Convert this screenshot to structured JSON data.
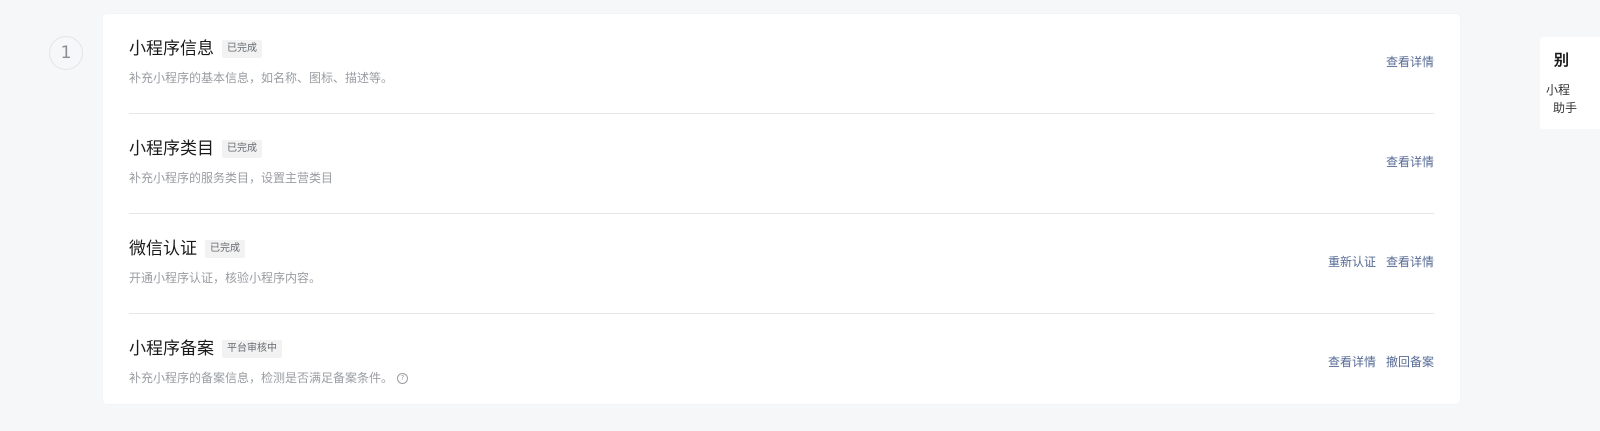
{
  "step": {
    "number": "1"
  },
  "items": [
    {
      "title": "小程序信息",
      "badge": "已完成",
      "desc": "补充小程序的基本信息，如名称、图标、描述等。",
      "actions": [
        "查看详情"
      ]
    },
    {
      "title": "小程序类目",
      "badge": "已完成",
      "desc": "补充小程序的服务类目，设置主营类目",
      "actions": [
        "查看详情"
      ]
    },
    {
      "title": "微信认证",
      "badge": "已完成",
      "desc": "开通小程序认证，核验小程序内容。",
      "actions": [
        "重新认证",
        "查看详情"
      ]
    },
    {
      "title": "小程序备案",
      "badge": "平台审核中",
      "desc": "补充小程序的备案信息，检测是否满足备案条件。",
      "actions": [
        "查看详情",
        "撤回备案"
      ]
    }
  ],
  "side_panel": {
    "title": "别",
    "line1": "小程",
    "line2": "助手"
  },
  "colors": {
    "link": "#576b95",
    "background": "#f6f7f9",
    "badge_bg": "#f2f2f2"
  }
}
